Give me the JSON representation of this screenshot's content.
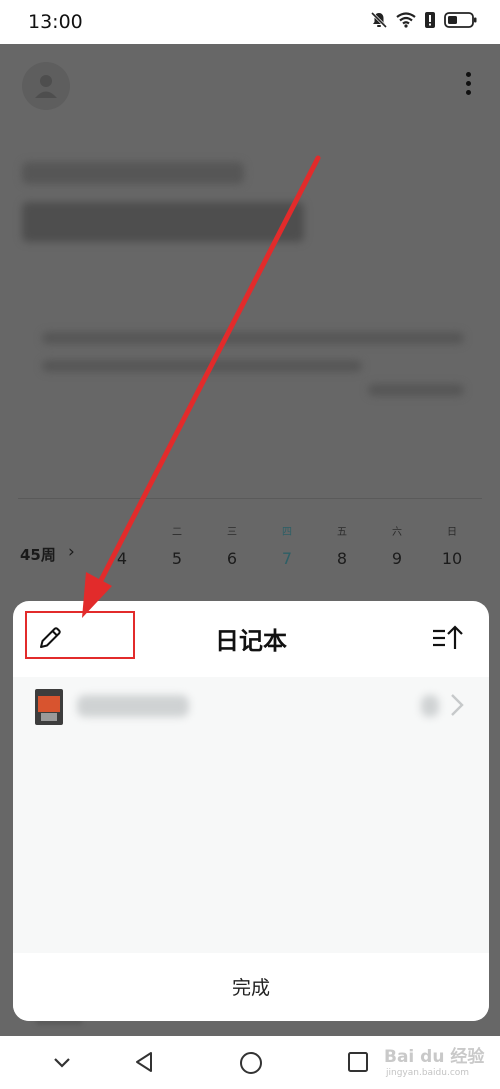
{
  "status_bar": {
    "time": "13:00",
    "icons": [
      "bell-off-icon",
      "wifi-icon",
      "alert-icon",
      "battery-icon"
    ]
  },
  "background_app": {
    "avatar_icon": "person-icon",
    "menu_icon": "more-vertical-icon",
    "week": {
      "label": "45周",
      "days": [
        {
          "weekday": "",
          "date": "4"
        },
        {
          "weekday": "二",
          "date": "5"
        },
        {
          "weekday": "三",
          "date": "6"
        },
        {
          "weekday": "四",
          "date": "7",
          "today": true
        },
        {
          "weekday": "五",
          "date": "8"
        },
        {
          "weekday": "六",
          "date": "9"
        },
        {
          "weekday": "日",
          "date": "10"
        }
      ]
    }
  },
  "sheet": {
    "title": "日记本",
    "edit_icon": "pencil-icon",
    "sort_icon": "sort-ascending-icon",
    "done_label": "完成"
  },
  "nav_bar": {
    "icons": [
      "chevron-down-icon",
      "back-triangle-icon",
      "home-circle-icon",
      "recents-square-icon"
    ]
  },
  "watermark": {
    "brand": "Bai du 经验",
    "sub": "jingyan.baidu.com"
  },
  "colors": {
    "annotation_red": "#e22b2b",
    "today_accent": "#2d5f66",
    "dim_overlay": "#676767"
  }
}
